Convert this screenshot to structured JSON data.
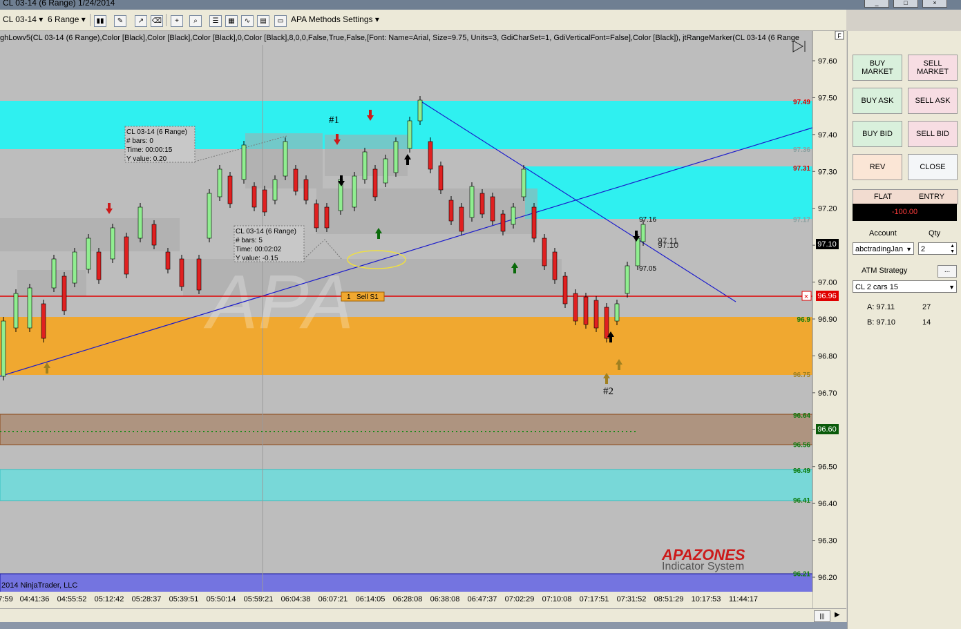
{
  "window": {
    "title": "CL 03-14 (6 Range)  1/24/2014"
  },
  "toolbar": {
    "instrument": "CL 03-14",
    "period": "6 Range",
    "settings_label": "APA Methods Settings"
  },
  "indicator_line": "ghLowv5(CL 03-14 (6 Range),Color [Black],Color [Black],Color [Black],0,Color [Black],8,0,0,False,True,False,[Font: Name=Arial, Size=9.75, Units=3, GdiCharSet=1, GdiVerticalFont=False],Color [Black]), jtRangeMarker(CL 03-14 (6 Range",
  "price_axis": {
    "ticks": [
      "97.60",
      "97.50",
      "97.40",
      "97.30",
      "97.20",
      "97.10",
      "97.00",
      "96.90",
      "96.80",
      "96.70",
      "96.60",
      "96.50",
      "96.40",
      "96.30",
      "96.20"
    ],
    "current_price": "97.10",
    "sell_order_price": "96.96",
    "green_level_price": "96.60"
  },
  "zone_labels": {
    "z1_top": "97.49",
    "z1_bottom": "97.36",
    "z2_top": "97.31",
    "z2_bottom": "97.17",
    "z3_top": "96.9",
    "z3_bottom": "96.75",
    "z4_top": "96.64",
    "z4_bottom": "96.56",
    "z5_top": "96.49",
    "z5_bottom": "96.41",
    "z6_top": "96.21"
  },
  "time_axis": [
    "7:59",
    "04:41:36",
    "04:55:52",
    "05:12:42",
    "05:28:37",
    "05:39:51",
    "05:50:14",
    "05:59:21",
    "06:04:38",
    "06:07:21",
    "06:14:05",
    "06:28:08",
    "06:38:08",
    "06:47:37",
    "07:02:29",
    "07:10:08",
    "07:17:51",
    "07:31:52",
    "08:51:29",
    "10:17:53",
    "11:44:17"
  ],
  "annotations": {
    "label1": "#1",
    "label2": "#2",
    "high_label": "97.16",
    "low_label": "97.05",
    "ask_label": "97.11",
    "bid_label": "97.10",
    "copyright": "2014 NinjaTrader, LLC",
    "logo_big": "APAZONES",
    "logo_small": "Indicator System",
    "sell_order_qty": "1",
    "sell_order_name": "Sell S1"
  },
  "measure_boxes": [
    {
      "lines": [
        "CL 03-14 (6 Range)",
        "# bars:   0",
        "Time:     00:00:15",
        "Y value: 0.20"
      ]
    },
    {
      "lines": [
        "CL 03-14 (6 Range)",
        "# bars:   5",
        "Time:     00:02:02",
        "Y value: -0.15"
      ]
    }
  ],
  "panel": {
    "buy_market": "BUY\nMARKET",
    "sell_market": "SELL\nMARKET",
    "buy_ask": "BUY ASK",
    "sell_ask": "SELL ASK",
    "buy_bid": "BUY BID",
    "sell_bid": "SELL BID",
    "rev": "REV",
    "close": "CLOSE",
    "flat": "FLAT",
    "entry": "ENTRY",
    "pnl": "-100.00",
    "account_label": "Account",
    "qty_label": "Qty",
    "account_value": "abctradingJan",
    "qty_value": "2",
    "atm_label": "ATM Strategy",
    "atm_button": "...",
    "atm_value": "CL 2 cars 15",
    "ask_row": {
      "label": "A: 97.11",
      "size": "27"
    },
    "bid_row": {
      "label": "B: 97.10",
      "size": "14"
    }
  },
  "colors": {
    "cyan_zone": "#2ff0f0",
    "orange_zone": "#f0a830",
    "brown_zone": "#ae9480",
    "teal_zone": "#78d8d8",
    "blue_zone": "#7474e0",
    "up_candle": "#90ee90",
    "down_candle": "#e02020"
  }
}
